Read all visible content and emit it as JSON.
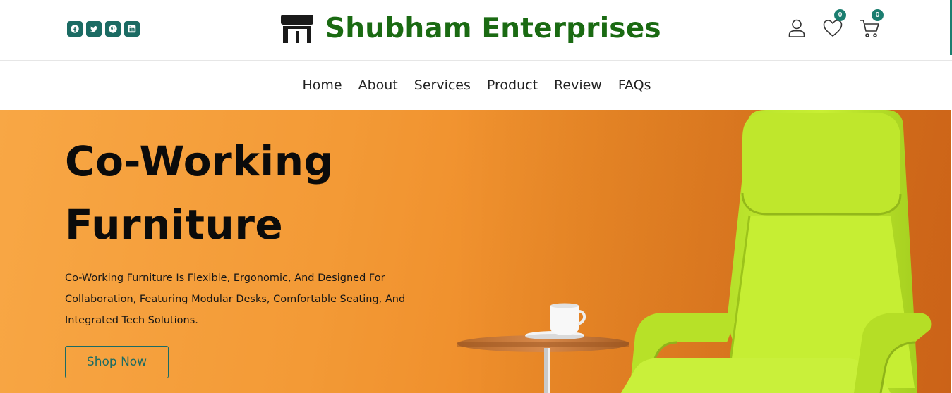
{
  "header": {
    "brand_name": "Shubham Enterprises",
    "socials": [
      "facebook-icon",
      "twitter-icon",
      "pinterest-icon",
      "linkedin-icon"
    ],
    "wishlist_count": "0",
    "cart_count": "0",
    "accent_color": "#1b6b63",
    "brand_color": "#1a6a12"
  },
  "nav": {
    "items": [
      "Home",
      "About",
      "Services",
      "Product",
      "Review",
      "FAQs"
    ]
  },
  "hero": {
    "title_line1": "Co-Working",
    "title_line2": "Furniture",
    "description": "Co-Working Furniture Is Flexible, Ergonomic, And Designed For Collaboration, Featuring Modular Desks, Comfortable Seating, And Integrated Tech Solutions.",
    "cta_label": "Shop Now",
    "background_color": "#f39a36"
  }
}
